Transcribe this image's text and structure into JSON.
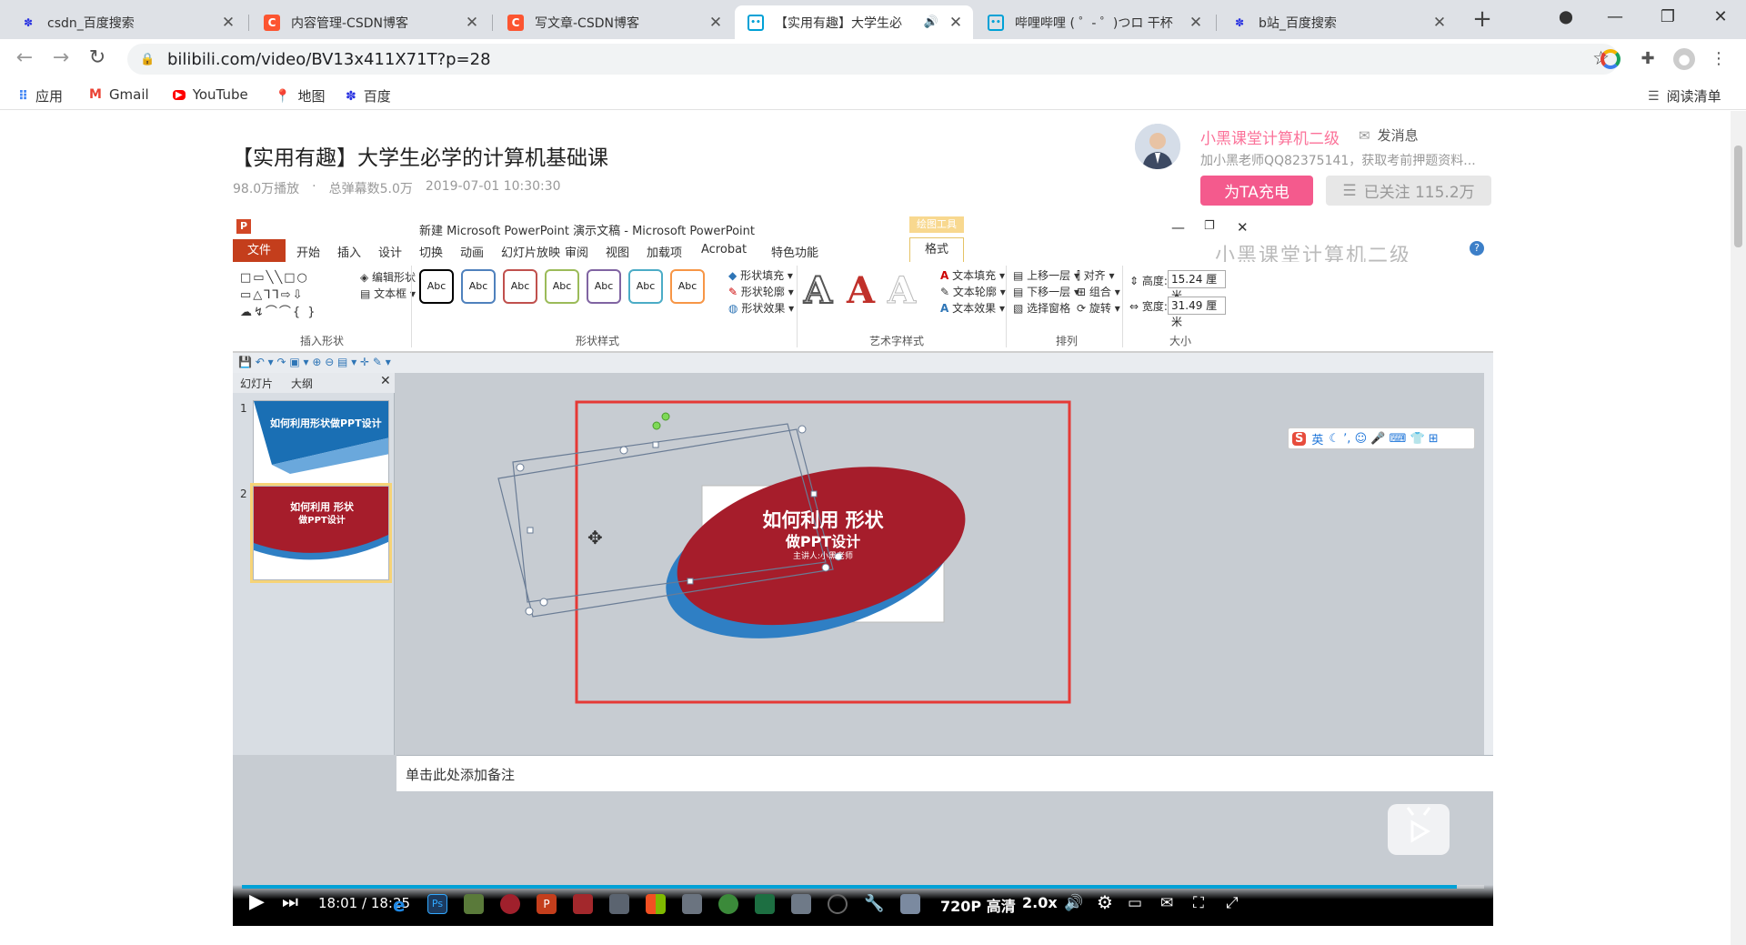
{
  "browser": {
    "tabs": [
      {
        "title": "csdn_百度搜索",
        "favicon": "baidu-paw-icon",
        "color": "#2932e1"
      },
      {
        "title": "内容管理-CSDN博客",
        "favicon": "csdn-c-icon",
        "color": "#fc5531"
      },
      {
        "title": "写文章-CSDN博客",
        "favicon": "csdn-c-icon",
        "color": "#fc5531"
      },
      {
        "title": "【实用有趣】大学生必",
        "favicon": "bilibili-tv-icon",
        "color": "#00a1d6"
      },
      {
        "title": "哔哩哔哩 ( ゜- ゜)つロ 干杯",
        "favicon": "bilibili-tv-icon",
        "color": "#00a1d6"
      },
      {
        "title": "b站_百度搜索",
        "favicon": "baidu-paw-icon",
        "color": "#2932e1"
      }
    ],
    "url": "bilibili.com/video/BV13x411X71T?p=28",
    "bookmarks": [
      {
        "label": "应用",
        "icon": "apps-grid-icon"
      },
      {
        "label": "Gmail",
        "icon": "gmail-icon"
      },
      {
        "label": "YouTube",
        "icon": "youtube-icon"
      },
      {
        "label": "地图",
        "icon": "maps-pin-icon"
      },
      {
        "label": "百度",
        "icon": "baidu-paw-icon"
      }
    ],
    "reading_list": "阅读清单"
  },
  "video": {
    "title": "【实用有趣】大学生必学的计算机基础课",
    "plays": "98.0万播放",
    "danmaku": "总弹幕数5.0万",
    "date": "2019-07-01 10:30:30"
  },
  "uploader": {
    "name": "小黑课堂计算机二级",
    "message": "发消息",
    "desc": "加小黑老师QQ82375141，获取考前押题资料...",
    "charge": "为TA充电",
    "follow": "已关注 115.2万"
  },
  "ppt": {
    "window_title": "新建 Microsoft PowerPoint 演示文稿 - Microsoft PowerPoint",
    "context_tab": "绘图工具",
    "tabs": [
      "文件",
      "开始",
      "插入",
      "设计",
      "切换",
      "动画",
      "幻灯片放映",
      "审阅",
      "视图",
      "加载项",
      "Acrobat",
      "特色功能",
      "格式"
    ],
    "watermark": "小黑课堂计算机二级",
    "groups": {
      "insert_shapes": "插入形状",
      "shape_styles": "形状样式",
      "art_styles": "艺术字样式",
      "arrange": "排列",
      "size": "大小"
    },
    "edit_shape": "编辑形状",
    "textbox": "文本框",
    "abc": "Abc",
    "shape_fill": "形状填充",
    "shape_outline": "形状轮廓",
    "shape_effect": "形状效果",
    "text_fill": "文本填充",
    "text_outline": "文本轮廓",
    "text_effect": "文本效果",
    "bring_forward": "上移一层",
    "send_backward": "下移一层",
    "selection_pane": "选择窗格",
    "align": "对齐",
    "group": "组合",
    "rotate": "旋转",
    "height_label": "高度:",
    "height_value": "15.24 厘米",
    "width_label": "宽度:",
    "width_value": "31.49 厘米",
    "panel_tabs": [
      "幻灯片",
      "大纲"
    ],
    "slide1_title": "如何利用形状做PPT设计",
    "slide2_title": "如何利用 形状",
    "slide2_sub": "做PPT设计",
    "slide_title": "如何利用 形状",
    "slide_subtitle": "做PPT设计",
    "slide_presenter": "主讲人:小黑老师",
    "notes_placeholder": "单击此处添加备注",
    "ime_label": "英"
  },
  "player": {
    "time": "18:01 / 18:25",
    "quality": "720P 高清",
    "speed": "2.0x",
    "progress_fraction": 0.978
  }
}
